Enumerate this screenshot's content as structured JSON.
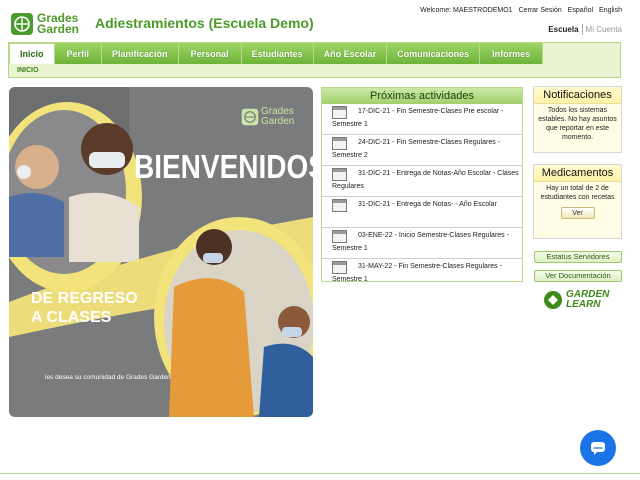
{
  "header": {
    "logo_line1": "Grades",
    "logo_line2": "Garden",
    "title": "Adiestramientos (Escuela Demo)",
    "welcome": "Welcome: MAESTRODEMO1",
    "logout": "Cerrar Sesión",
    "lang_es": "Español",
    "lang_en": "English",
    "school": "Escuela",
    "account": "Mi Cuenta"
  },
  "nav": {
    "tabs": [
      "Inicio",
      "Perfil",
      "Planificación",
      "Personal",
      "Estudiantes",
      "Año Escolar",
      "Comunicaciones",
      "Informes"
    ],
    "breadcrumb": "INICIO"
  },
  "banner": {
    "logo_line1": "Grades",
    "logo_line2": "Garden",
    "heading": "BIENVENIDOS",
    "line1": "DE REGRESO",
    "line2": "A CLASES",
    "wish": "les desea su comunidad de Grades Garden"
  },
  "activities": {
    "title": "Próximas actividades",
    "items": [
      "17-DIC-21 - Fin Semestre-Clases Pre escolar - Semestre 1",
      "24-DIC-21 - Fin Semestre-Clases Regulares - Semestre 2",
      "31-DIC-21 - Entrega de Notas-Año Escolar - Clases Regulares",
      "31-DIC-21 - Entrega de Notas- - Año Escolar",
      "03-ENE-22 - Inicio Semestre-Clases Regulares - Semestre 1",
      "31-MAY-22 - Fin Semestre-Clases Regulares - Semestre 1"
    ]
  },
  "notifications": {
    "title": "Notificaciones",
    "body": "Todos los sistemas estables. No hay asuntos que reportar en este momento."
  },
  "medications": {
    "title": "Medicamentos",
    "body": "Hay un total de 2 de estudiantes con recetas",
    "button": "Ver"
  },
  "side_buttons": {
    "status": "Estatus Servidores",
    "docs": "Ver Documentación"
  },
  "garden_learn": {
    "line1": "GARDEN",
    "line2": "LEARN"
  },
  "colors": {
    "brand_green": "#4c9a2a",
    "chat_blue": "#1b73e8"
  }
}
